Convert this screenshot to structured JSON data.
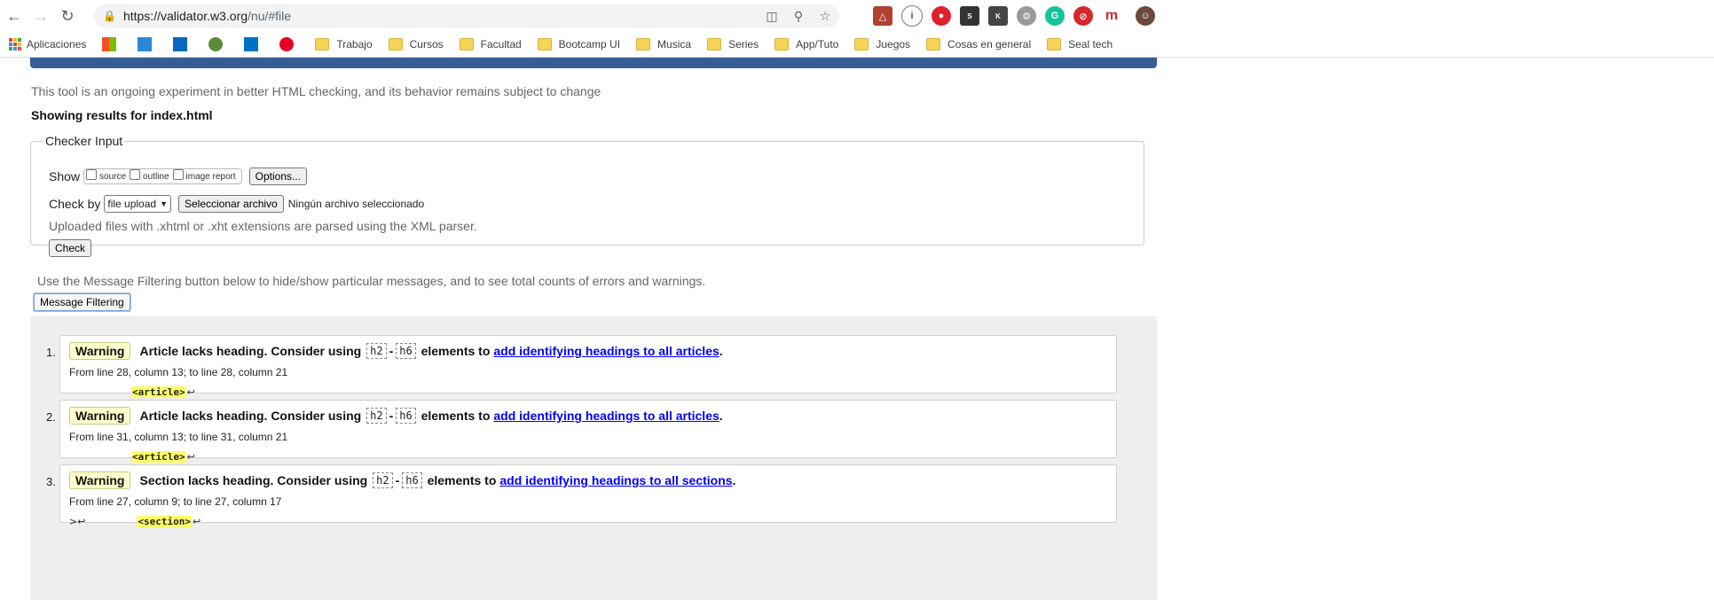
{
  "browser": {
    "url_host": "https://validator.w3.org",
    "url_path": "/nu/#file",
    "bookmarks": {
      "apps": "Aplicaciones",
      "folders": [
        "Trabajo",
        "Cursos",
        "Facultad",
        "Bootcamp UI",
        "Musica",
        "Series",
        "App/Tuto",
        "Juegos",
        "Cosas en general",
        "Seal tech"
      ]
    },
    "colors": {
      "accent_bar": "#365d95",
      "warning_bg": "#ffffcc",
      "highlight": "#ffff66",
      "link": "#0000ff"
    }
  },
  "page": {
    "intro": "This tool is an ongoing experiment in better HTML checking, and its behavior remains subject to change",
    "showing_results": "Showing results for index.html",
    "checker": {
      "legend": "Checker Input",
      "show_label": "Show",
      "show_options": [
        "source",
        "outline",
        "image report"
      ],
      "options_button": "Options...",
      "check_by_label": "Check by",
      "check_by_value": "file upload",
      "file_button": "Seleccionar archivo",
      "no_file": "Ningún archivo seleccionado",
      "xml_note": "Uploaded files with .xhtml or .xht extensions are parsed using the XML parser.",
      "check_button": "Check"
    },
    "filter_note": "Use the Message Filtering button below to hide/show particular messages, and to see total counts of errors and warnings.",
    "filter_button": "Message Filtering"
  },
  "messages": [
    {
      "num": "1.",
      "type": "Warning",
      "text": "Article lacks heading. Consider using",
      "code_a": "h2",
      "sep": "-",
      "code_b": "h6",
      "mid": "elements to",
      "link": "add identifying headings to all articles",
      "end": ".",
      "location": "From line 28, column 13; to line 28, column 21",
      "lead": "",
      "extract": "<article>",
      "ret": "↩"
    },
    {
      "num": "2.",
      "type": "Warning",
      "text": "Article lacks heading. Consider using",
      "code_a": "h2",
      "sep": "-",
      "code_b": "h6",
      "mid": "elements to",
      "link": "add identifying headings to all articles",
      "end": ".",
      "location": "From line 31, column 13; to line 31, column 21",
      "lead": "",
      "extract": "<article>",
      "ret": "↩"
    },
    {
      "num": "3.",
      "type": "Warning",
      "text": "Section lacks heading. Consider using",
      "code_a": "h2",
      "sep": "-",
      "code_b": "h6",
      "mid": "elements to",
      "link": "add identifying headings to all sections",
      "end": ".",
      "location": "From line 27, column 9; to line 27, column 17",
      "lead": ">↩",
      "extract": "<section>",
      "ret": "↩"
    }
  ]
}
